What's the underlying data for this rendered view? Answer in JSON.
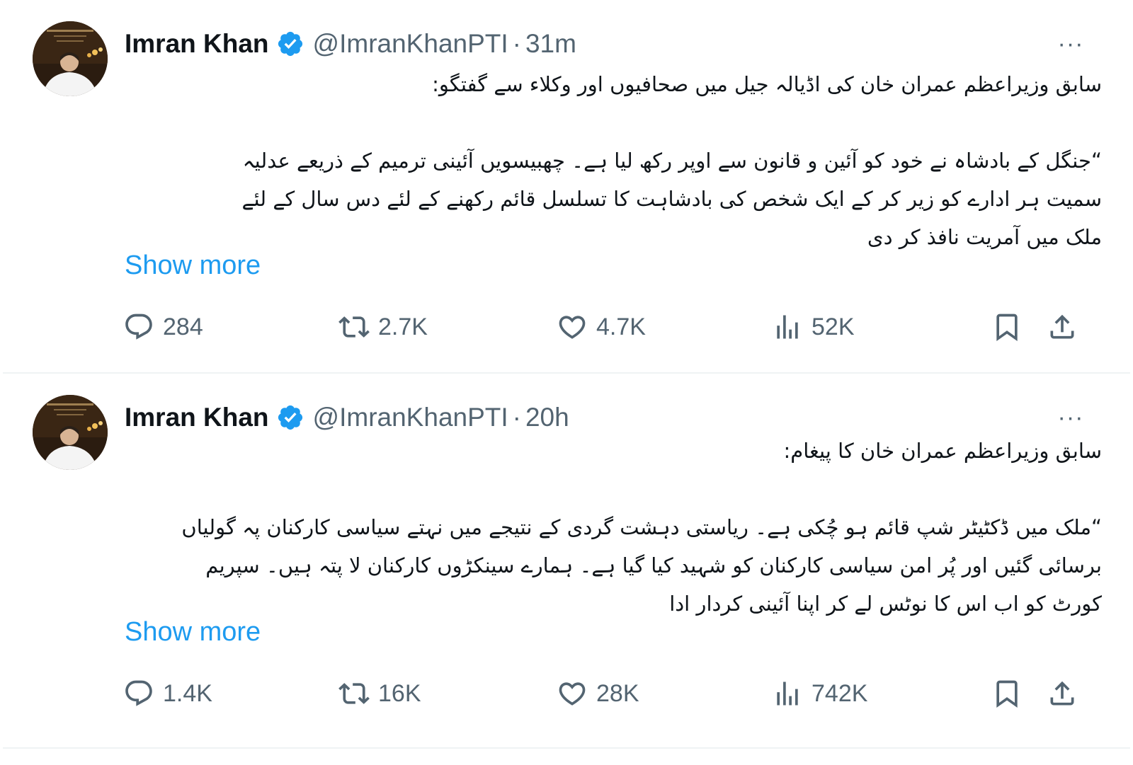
{
  "tweets": [
    {
      "author": {
        "name": "Imran Khan",
        "verified_icon": "verified-badge-icon",
        "handle": "@ImranKhanPTI",
        "separator": "·",
        "time": "31m"
      },
      "more_menu": "···",
      "text_lead": "سابق وزیراعظم عمران خان کی اڈیالہ جیل میں صحافیوں اور وکلاء سے گفتگو:",
      "text_lines": [
        "“جنگل کے بادشاہ نے خود کو آئین و قانون سے اوپر رکھ لیا ہے۔ چھبیسویں آئینی ترمیم کے ذریعے عدلیہ",
        "سمیت ہر ادارے کو زیر کر کے ایک شخص کی بادشاہت کا تسلسل قائم رکھنے کے لئے دس سال کے لئے",
        "ملک میں آمریت نافذ کر دی"
      ],
      "show_more": "Show more",
      "stats": {
        "replies": "284",
        "reposts": "2.7K",
        "likes": "4.7K",
        "views": "52K"
      }
    },
    {
      "author": {
        "name": "Imran Khan",
        "verified_icon": "verified-badge-icon",
        "handle": "@ImranKhanPTI",
        "separator": "·",
        "time": "20h"
      },
      "more_menu": "···",
      "text_lead": "سابق وزیراعظم عمران خان کا پیغام:",
      "text_lines": [
        "“ملک میں ڈکٹیٹر شپ قائم ہو چُکی ہے۔ ریاستی دہشت گردی کے نتیجے میں نہتے سیاسی کارکنان پہ گولیاں",
        "برسائی گئیں اور پُر امن سیاسی کارکنان کو شہید کیا گیا ہے۔ ہمارے سینکڑوں کارکنان لا پتہ ہیں۔ سپریم",
        "کورٹ کو اب اس کا نوٹس لے کر اپنا آئینی کردار ادا"
      ],
      "show_more": "Show more",
      "stats": {
        "replies": "1.4K",
        "reposts": "16K",
        "likes": "28K",
        "views": "742K"
      }
    }
  ],
  "colors": {
    "text": "#0f1419",
    "muted": "#536471",
    "link": "#1d9bf0",
    "verified": "#1d9bf0",
    "divider": "#eff3f4"
  }
}
